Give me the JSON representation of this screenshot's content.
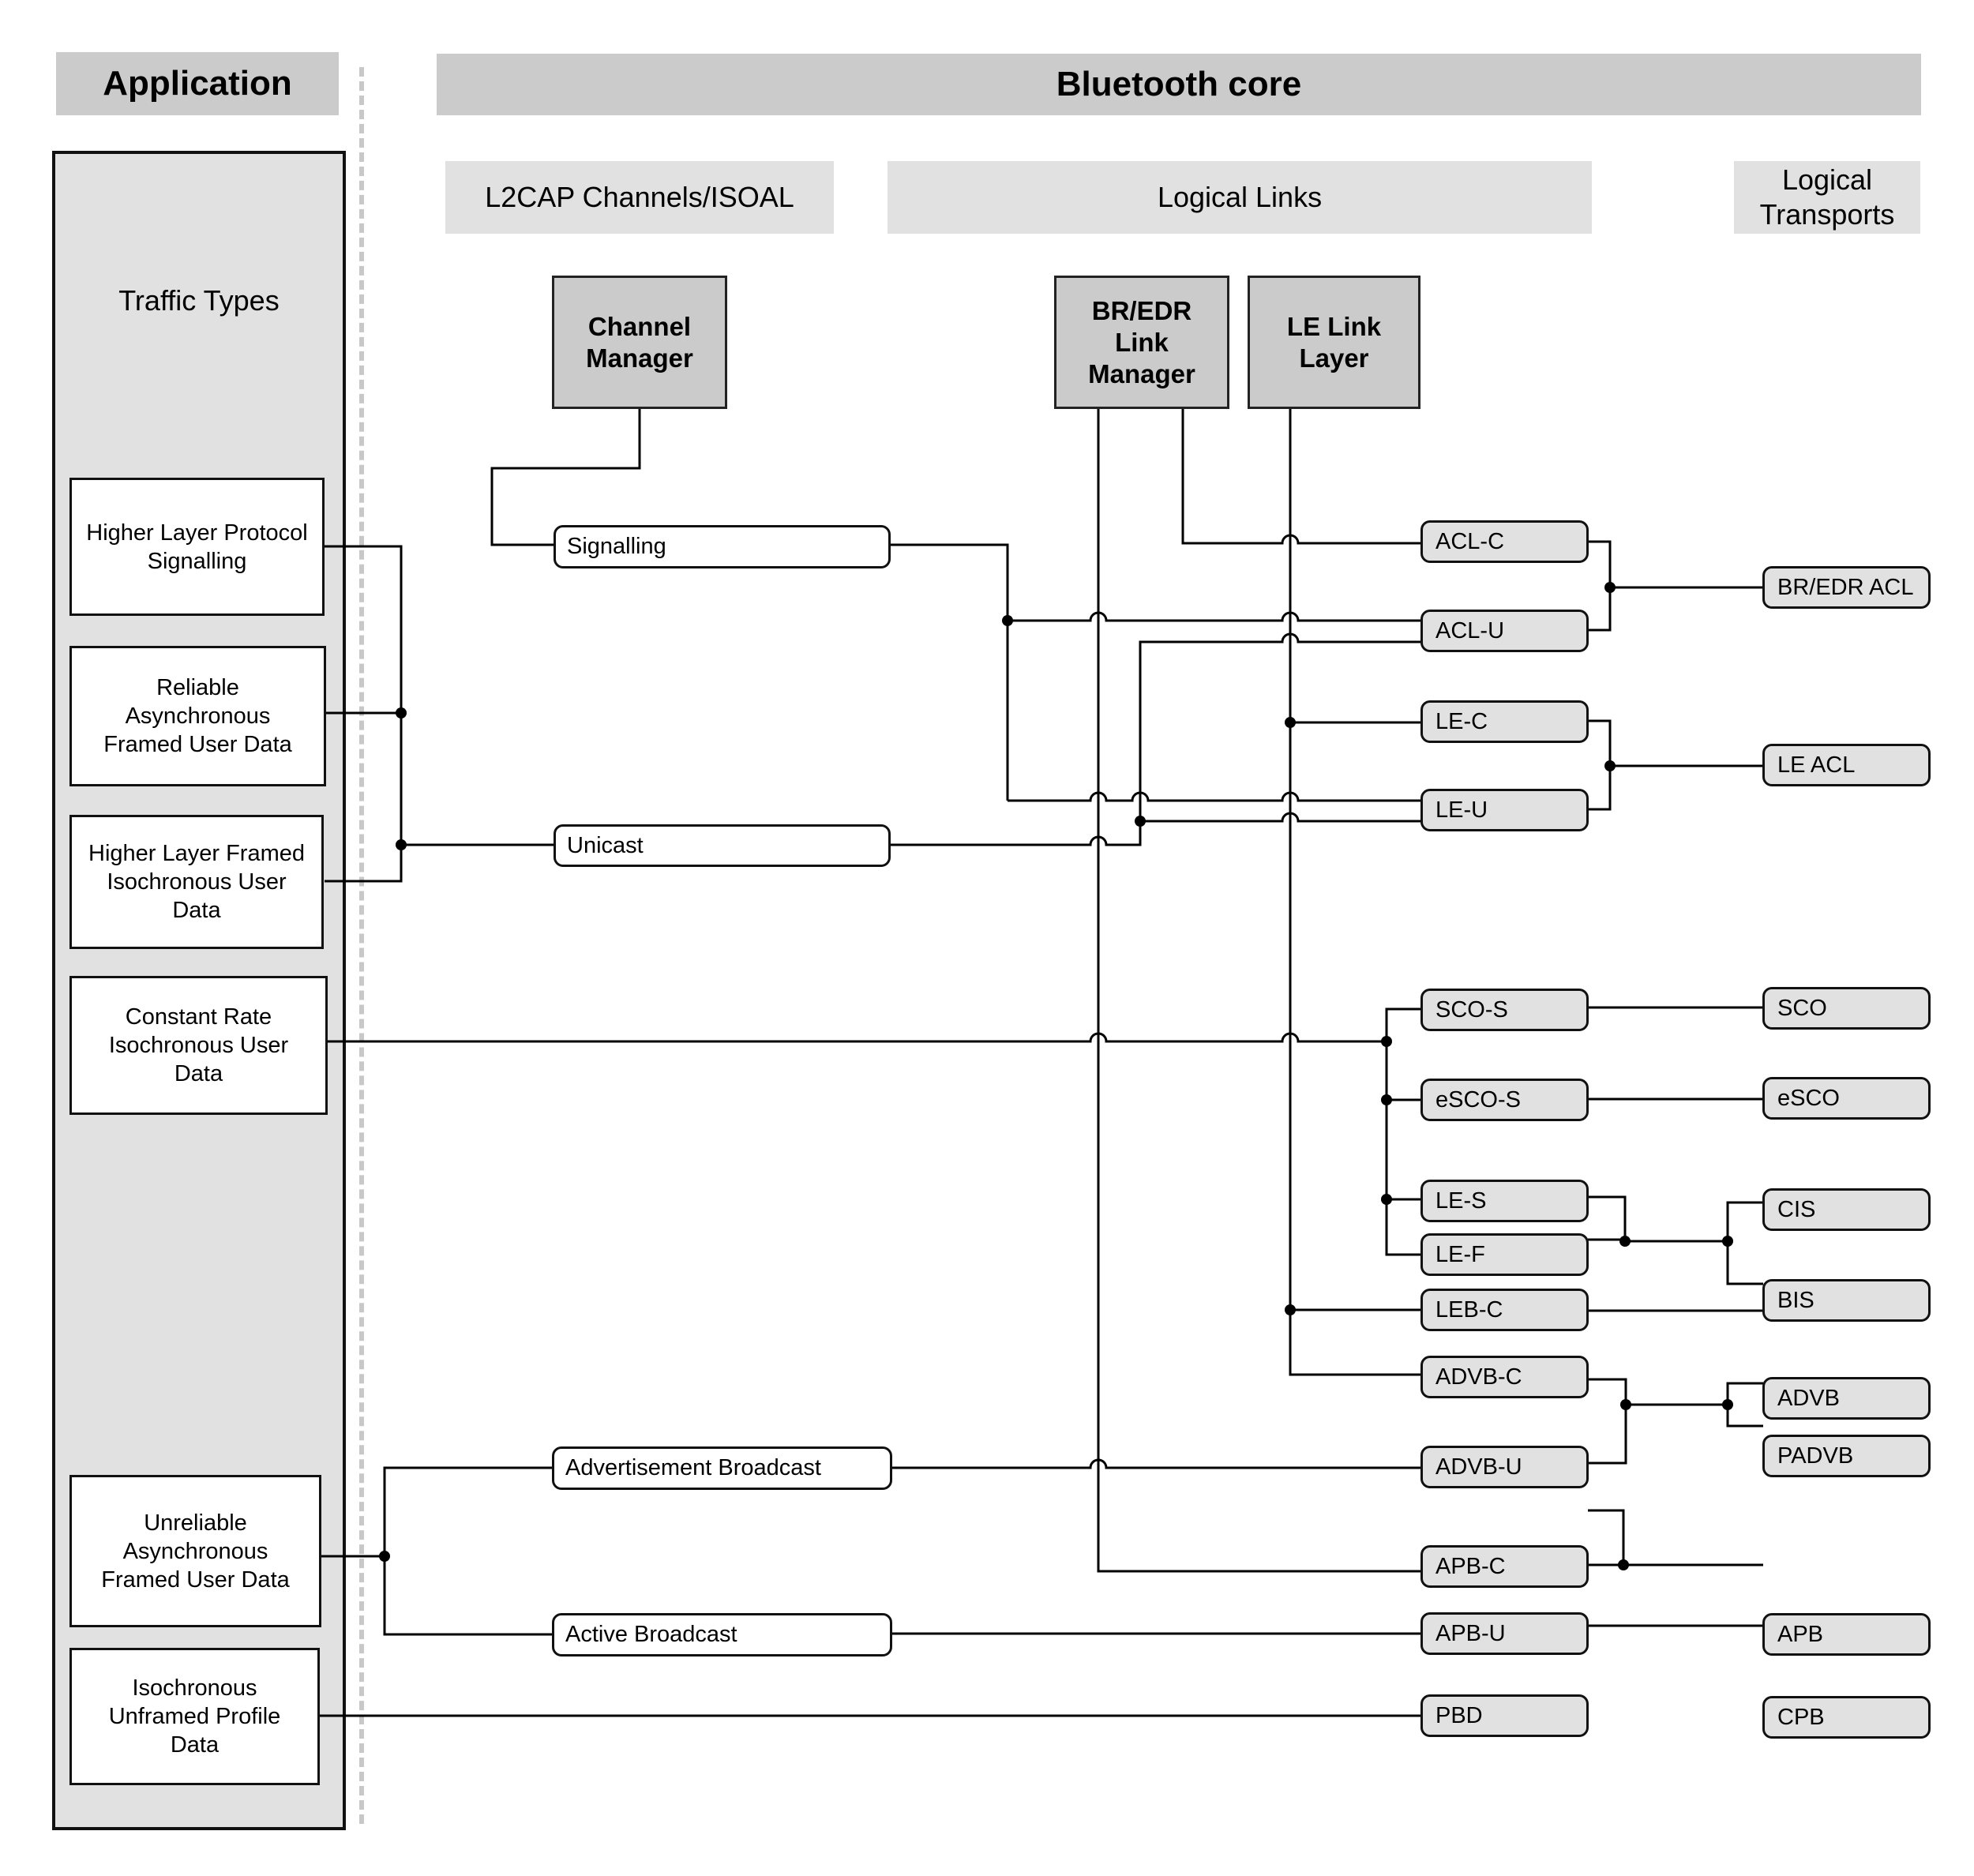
{
  "headers": {
    "application": "Application",
    "bluetooth_core": "Bluetooth core"
  },
  "columns": {
    "l2cap": "L2CAP Channels/ISOAL",
    "logical_links": "Logical Links",
    "logical_transports": "Logical\nTransports"
  },
  "traffic_types": {
    "title": "Traffic Types",
    "items": [
      "Higher Layer Protocol\nSignalling",
      "Reliable\nAsynchronous\nFramed User Data",
      "Higher Layer Framed\nIsochronous User\nData",
      "Constant Rate\nIsochronous User\nData",
      "Unreliable\nAsynchronous\nFramed User Data",
      "Isochronous\nUnframed Profile\nData"
    ]
  },
  "managers": {
    "channel_manager": "Channel\nManager",
    "bredr_link_manager": "BR/EDR\nLink\nManager",
    "le_link_layer": "LE Link\nLayer"
  },
  "channels": [
    "Signalling",
    "Unicast",
    "Advertisement Broadcast",
    "Active Broadcast"
  ],
  "logical_links": [
    "ACL-C",
    "ACL-U",
    "LE-C",
    "LE-U",
    "SCO-S",
    "eSCO-S",
    "LE-S",
    "LE-F",
    "LEB-C",
    "ADVB-C",
    "ADVB-U",
    "APB-C",
    "APB-U",
    "PBD"
  ],
  "logical_transports": [
    "BR/EDR ACL",
    "LE ACL",
    "SCO",
    "eSCO",
    "CIS",
    "BIS",
    "ADVB",
    "PADVB",
    "APB",
    "CPB"
  ]
}
